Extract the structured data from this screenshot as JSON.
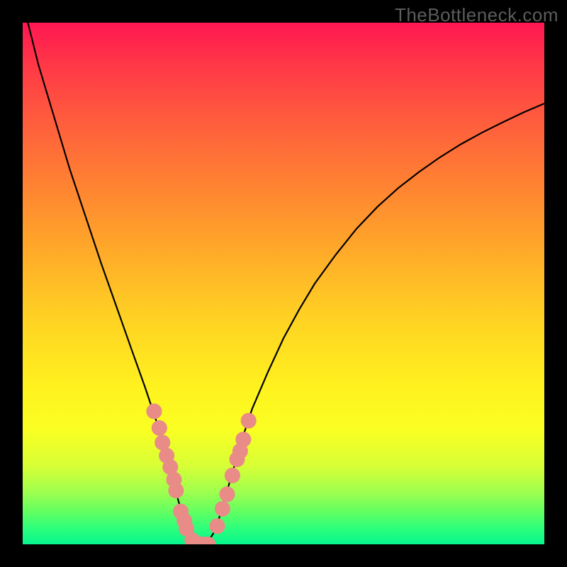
{
  "watermark": "TheBottleneck.com",
  "chart_data": {
    "type": "line",
    "title": "",
    "xlabel": "",
    "ylabel": "",
    "xlim": [
      0,
      100
    ],
    "ylim": [
      0,
      100
    ],
    "grid": false,
    "legend": false,
    "series": [
      {
        "name": "curve",
        "x": [
          1,
          3,
          6,
          9,
          12,
          15,
          18,
          21,
          23.5,
          25.5,
          27,
          28.2,
          29.4,
          30.5,
          31.5,
          32.5,
          33.5,
          34.5,
          35.5,
          36.5,
          37.5,
          38.5,
          40,
          42,
          44,
          47,
          50,
          53,
          56,
          60,
          64,
          68,
          72,
          76,
          80,
          84,
          88,
          92,
          96,
          100
        ],
        "y": [
          100,
          92,
          82,
          72,
          63,
          54,
          45.5,
          37,
          30,
          24,
          19,
          15,
          10,
          6,
          3,
          1,
          0,
          0,
          0.5,
          2,
          4.5,
          8,
          13,
          20,
          26,
          33,
          39.5,
          45,
          50,
          55.5,
          60.5,
          64.7,
          68.3,
          71.4,
          74.2,
          76.7,
          78.9,
          80.9,
          82.8,
          84.5
        ]
      }
    ],
    "markers": {
      "name": "dots",
      "color": "#e98b86",
      "radius_pct": 1.5,
      "points_xy": [
        [
          25.2,
          25.5
        ],
        [
          26.2,
          22.3
        ],
        [
          26.8,
          19.5
        ],
        [
          27.6,
          17.0
        ],
        [
          28.3,
          14.8
        ],
        [
          29.0,
          12.4
        ],
        [
          29.4,
          10.3
        ],
        [
          30.3,
          6.3
        ],
        [
          31.0,
          4.5
        ],
        [
          31.4,
          3.0
        ],
        [
          32.5,
          0.8
        ],
        [
          33.3,
          0.0
        ],
        [
          34.5,
          0.0
        ],
        [
          35.5,
          0.0
        ],
        [
          37.3,
          3.5
        ],
        [
          38.3,
          6.8
        ],
        [
          39.2,
          9.6
        ],
        [
          40.2,
          13.2
        ],
        [
          41.1,
          16.3
        ],
        [
          41.7,
          17.9
        ],
        [
          42.3,
          20.1
        ],
        [
          43.3,
          23.7
        ]
      ]
    },
    "background": {
      "type": "vertical-gradient",
      "stops": [
        {
          "pos": 0.0,
          "color": "#ff1752"
        },
        {
          "pos": 0.3,
          "color": "#ff7f33"
        },
        {
          "pos": 0.7,
          "color": "#fff21f"
        },
        {
          "pos": 0.9,
          "color": "#9eff4e"
        },
        {
          "pos": 1.0,
          "color": "#07f58e"
        }
      ]
    }
  }
}
